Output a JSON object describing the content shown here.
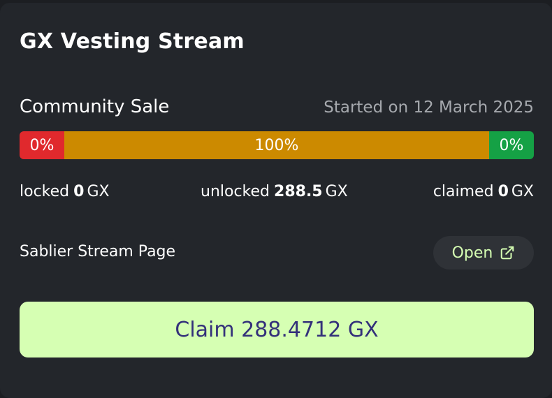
{
  "card": {
    "title": "GX Vesting Stream"
  },
  "stream": {
    "name": "Community Sale",
    "started": "Started on 12 March 2025"
  },
  "progress": {
    "locked_pct_label": "0%",
    "unlocked_pct_label": "100%",
    "claimed_pct_label": "0%",
    "unlocked_fraction": 1.0,
    "colors": {
      "locked": "#e0292d",
      "unlocked": "#cc8a00",
      "claimed": "#15a145"
    }
  },
  "amounts": {
    "locked_label": "locked",
    "locked_value": "0",
    "unlocked_label": "unlocked",
    "unlocked_value": "288.5",
    "claimed_label": "claimed",
    "claimed_value": "0",
    "unit": "GX"
  },
  "sablier": {
    "label": "Sablier Stream Page",
    "open_label": "Open",
    "open_icon": "external-link-icon"
  },
  "claim": {
    "label": "Claim 288.4712 GX",
    "accent": "#d6ffb3"
  }
}
